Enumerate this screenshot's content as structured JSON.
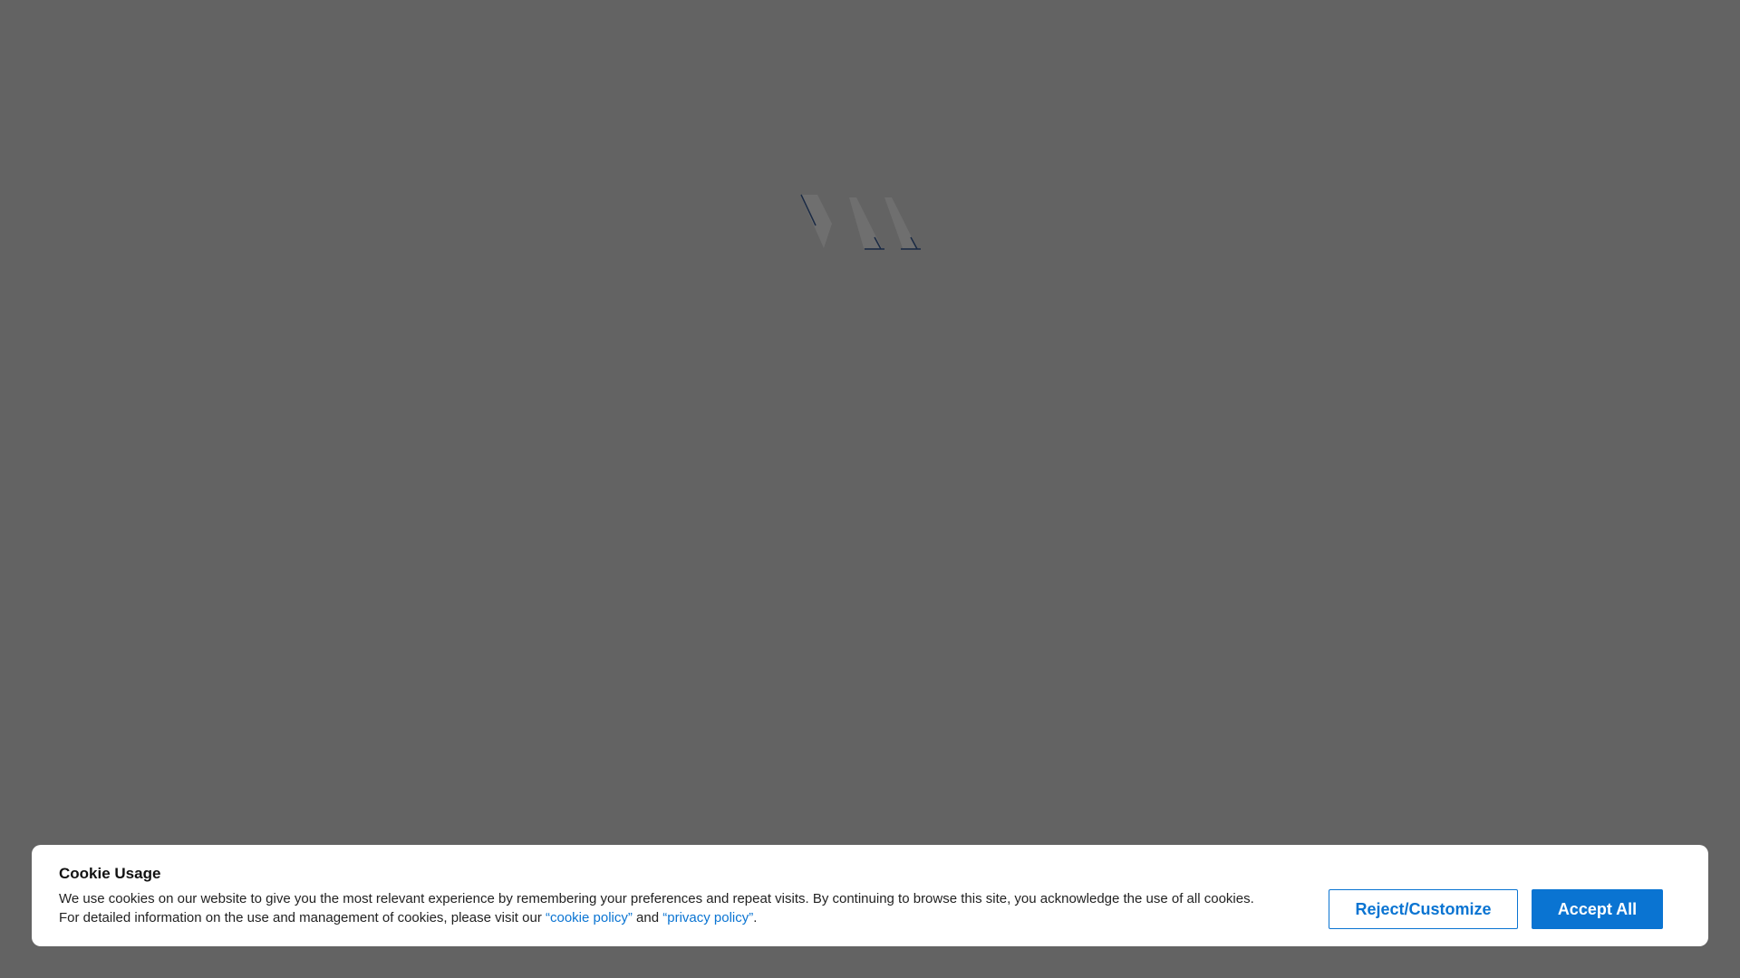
{
  "loader": {
    "icon": "loading-logo-icon",
    "colors": {
      "stroke": "#1a2a44",
      "fill": "#6f6f6f"
    }
  },
  "cookie_banner": {
    "title": "Cookie Usage",
    "text_before": "We use cookies on our website to give you the most relevant experience by remembering your preferences and repeat visits. By continuing to browse this site, you acknowledge the use of all cookies. For detailed information on the use and management of cookies, please visit our ",
    "cookie_policy_link": "“cookie policy”",
    "text_between": " and ",
    "privacy_policy_link": "“privacy policy”",
    "text_after": ".",
    "reject_button_label": "Reject/Customize",
    "accept_button_label": "Accept All",
    "colors": {
      "accent": "#0a74d2",
      "background": "#ffffff",
      "overlay": "#636363"
    }
  }
}
